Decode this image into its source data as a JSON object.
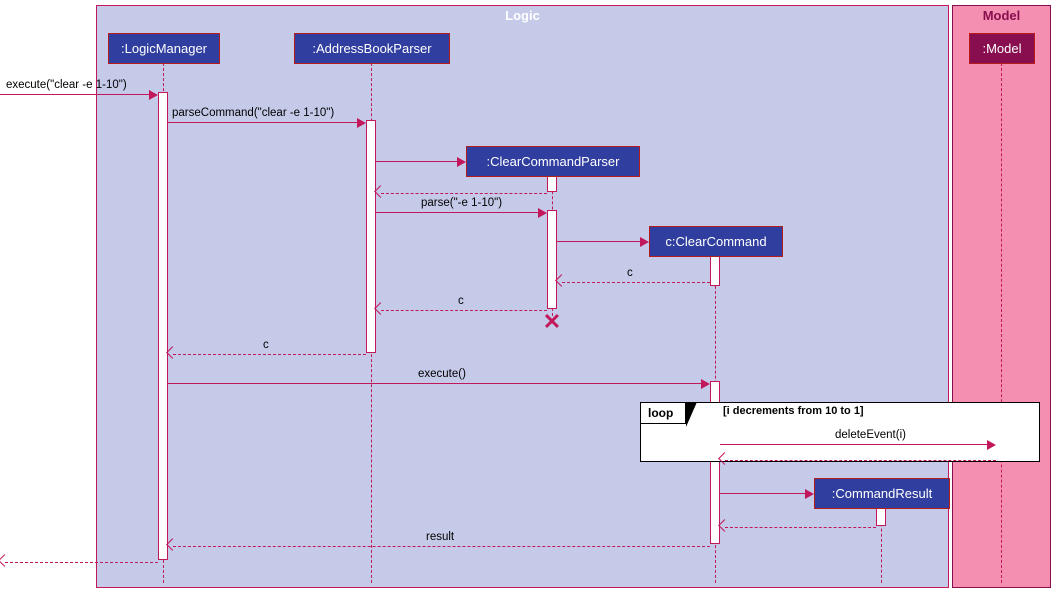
{
  "frames": {
    "logic": "Logic",
    "model": "Model"
  },
  "lifelines": {
    "logicManager": ":LogicManager",
    "addressBookParser": ":AddressBookParser",
    "clearCommandParser": ":ClearCommandParser",
    "clearCommand": "c:ClearCommand",
    "commandResult": ":CommandResult",
    "model": ":Model"
  },
  "messages": {
    "execute1": "execute(\"clear -e 1-10\")",
    "parseCommand": "parseCommand(\"clear -e 1-10\")",
    "parse": "parse(\"-e 1-10\")",
    "returnC1": "c",
    "returnC2": "c",
    "returnC3": "c",
    "execute2": "execute()",
    "deleteEvent": "deleteEvent(i)",
    "result": "result"
  },
  "loop": {
    "label": "loop",
    "guard": "[i decrements from 10 to 1]"
  }
}
